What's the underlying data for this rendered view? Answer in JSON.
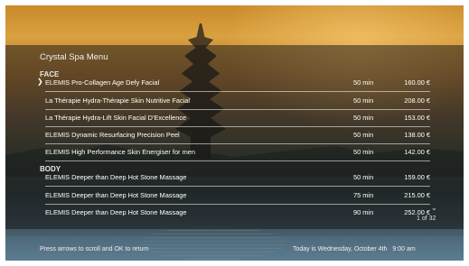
{
  "menu": {
    "title": "Crystal Spa Menu",
    "sections": [
      {
        "header": "FACE",
        "items": [
          {
            "name": "ELEMIS Pro-Collagen Age Defy Facial",
            "duration": "50 min",
            "price": "160.00 €",
            "selected": true
          },
          {
            "name": "La Thérapie Hydra-Thérapie Skin Nutritive Facial",
            "duration": "50 min",
            "price": "208.00 €"
          },
          {
            "name": "La Thérapie Hydra-Lift Skin Facial D'Excellence",
            "duration": "50 min",
            "price": "153.00 €"
          },
          {
            "name": "ELEMIS Dynamic Resurfacing Precision Peel",
            "duration": "50 min",
            "price": "138.00 €"
          },
          {
            "name": "ELEMIS High Performance Skin Energiser for men",
            "duration": "50 min",
            "price": "142.00 €"
          }
        ]
      },
      {
        "header": "BODY",
        "items": [
          {
            "name": "ELEMIS Deeper than Deep Hot Stone Massage",
            "duration": "50 min",
            "price": "159.00 €"
          },
          {
            "name": "ELEMIS Deeper than Deep Hot Stone Massage",
            "duration": "75 min",
            "price": "215.00 €"
          },
          {
            "name": "ELEMIS Deeper than Deep Hot Stone Massage",
            "duration": "90 min",
            "price": "252.00 €"
          }
        ]
      }
    ],
    "page_indicator": "1 of 32",
    "scroll_icon": "chevron-down-icon",
    "selection_icon": "chevron-right-icon"
  },
  "footer": {
    "hint": "Press arrows to scroll and OK to return",
    "date": "Today is Wednesday, October 4th",
    "time": "9:00 am"
  }
}
